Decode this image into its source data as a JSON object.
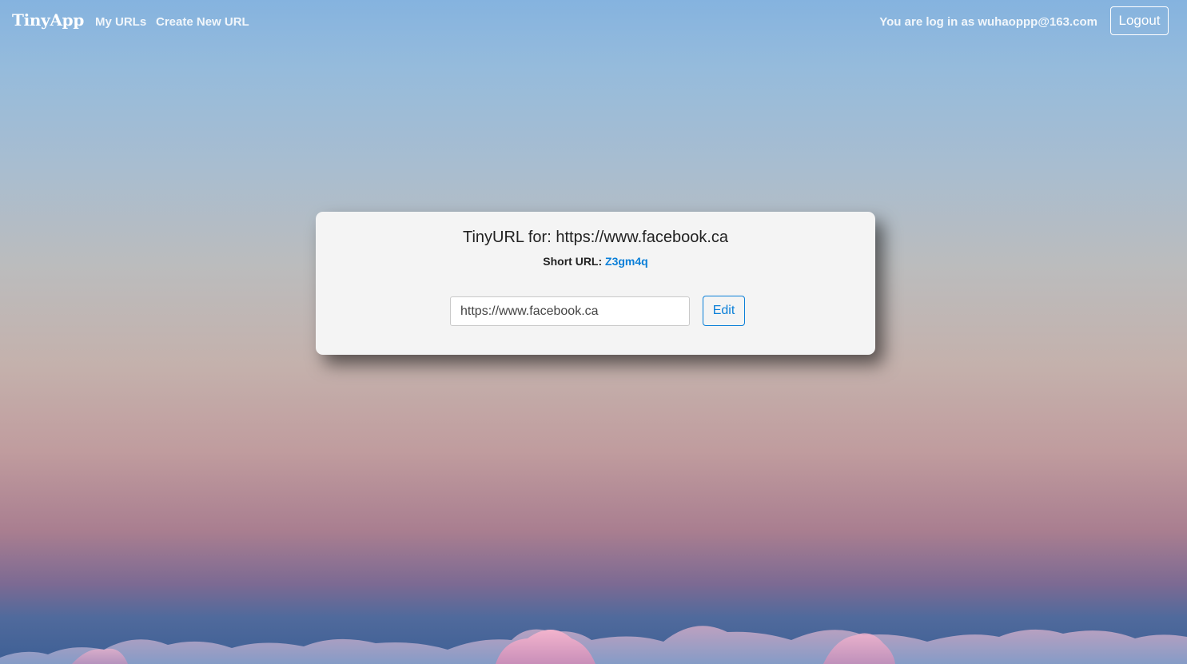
{
  "navbar": {
    "brand": "TinyApp",
    "links": [
      {
        "label": "My URLs"
      },
      {
        "label": "Create New URL"
      }
    ],
    "login_prefix": "You are log in as",
    "user_email": "wuhaoppp@163.com",
    "logout_label": "Logout"
  },
  "card": {
    "title_prefix": "TinyURL for:",
    "long_url": "https://www.facebook.ca",
    "short_url_label": "Short URL:",
    "short_url_id": "Z3gm4q",
    "input_value": "https://www.facebook.ca",
    "edit_label": "Edit"
  },
  "colors": {
    "accent": "#0a7fd8",
    "card_bg": "#f4f4f4",
    "nav_text": "#ffffff"
  }
}
